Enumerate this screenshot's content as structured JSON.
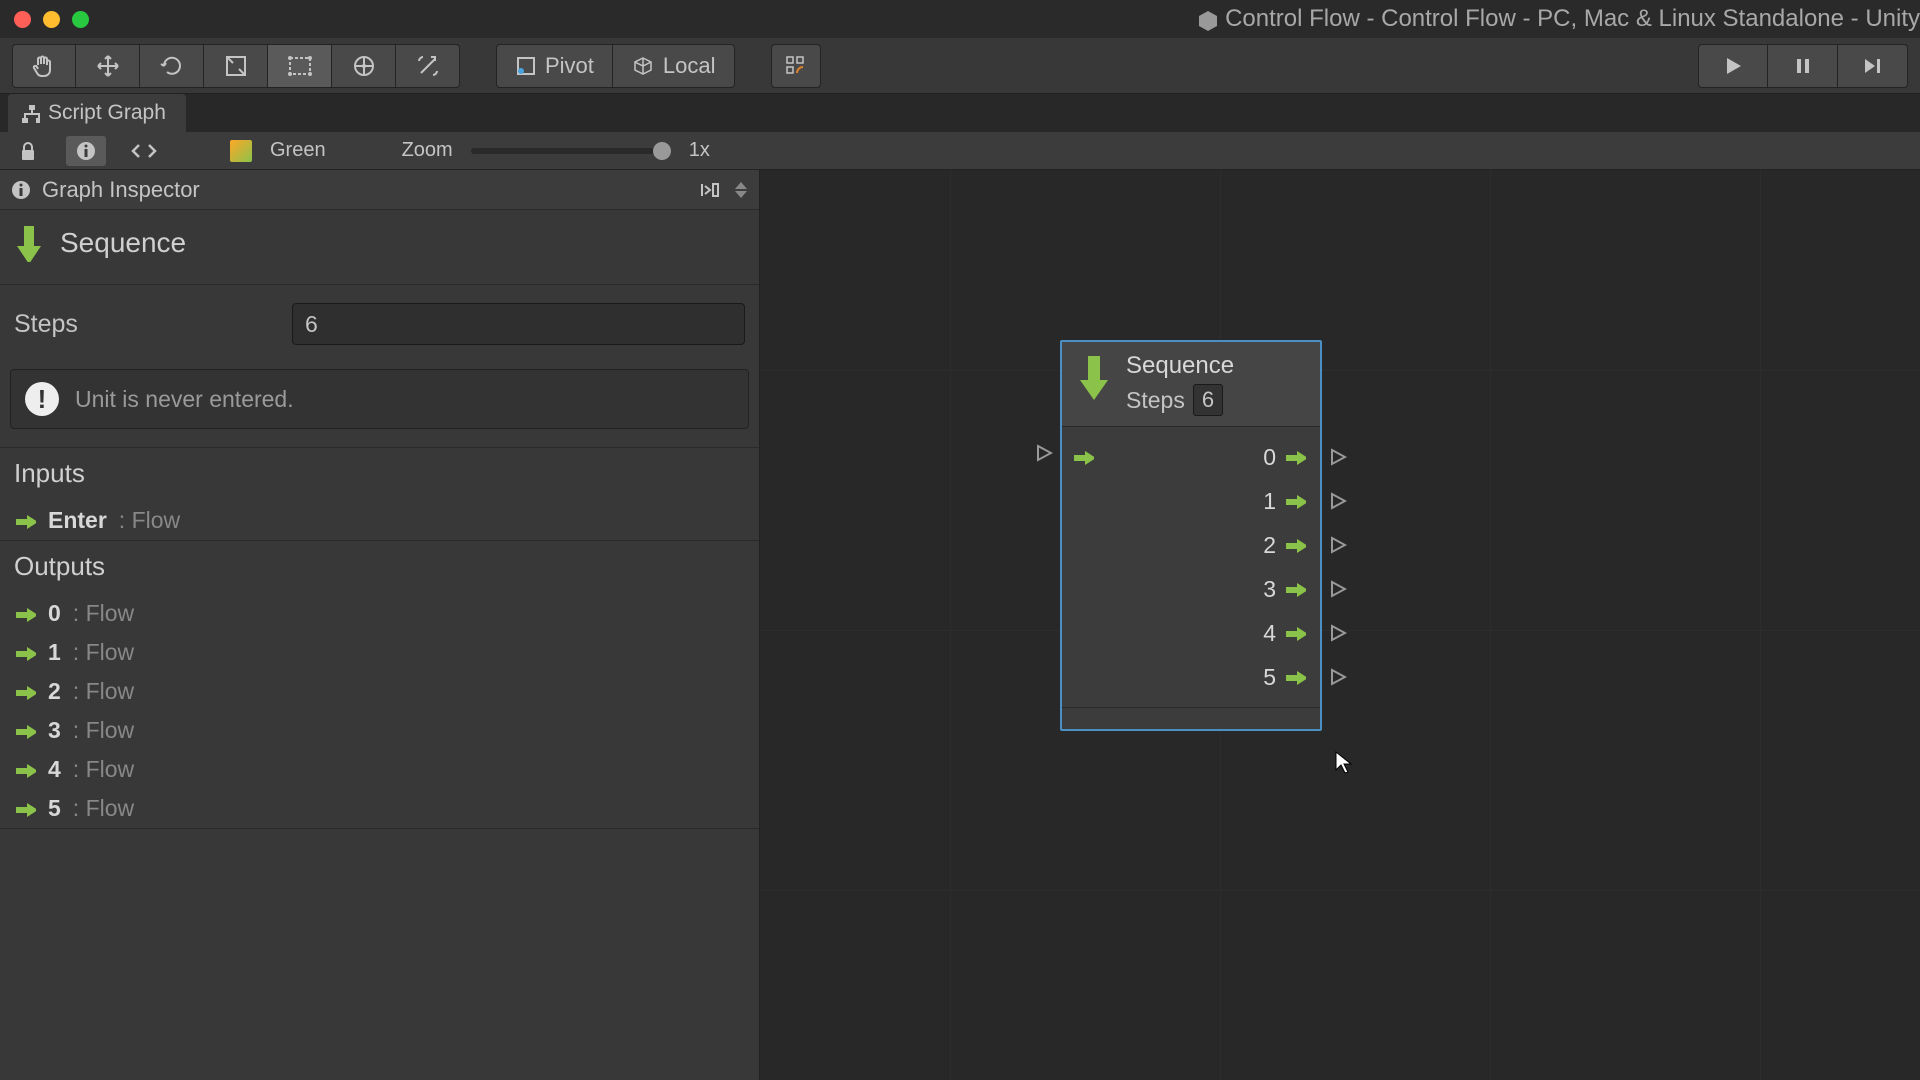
{
  "window": {
    "title": "Control Flow - Control Flow - PC, Mac & Linux Standalone - Unity"
  },
  "toolbar": {
    "pivot_label": "Pivot",
    "local_label": "Local"
  },
  "tabs": {
    "script_graph": "Script Graph"
  },
  "sub_bar": {
    "context_label": "Green",
    "zoom_label": "Zoom",
    "zoom_value": "1x"
  },
  "inspector": {
    "title": "Graph Inspector",
    "node_title": "Sequence",
    "steps_label": "Steps",
    "steps_value": "6",
    "warning": "Unit is never entered.",
    "inputs_label": "Inputs",
    "inputs": [
      {
        "name": "Enter",
        "type": "Flow"
      }
    ],
    "outputs_label": "Outputs",
    "outputs": [
      {
        "name": "0",
        "type": "Flow"
      },
      {
        "name": "1",
        "type": "Flow"
      },
      {
        "name": "2",
        "type": "Flow"
      },
      {
        "name": "3",
        "type": "Flow"
      },
      {
        "name": "4",
        "type": "Flow"
      },
      {
        "name": "5",
        "type": "Flow"
      }
    ]
  },
  "node": {
    "title": "Sequence",
    "steps_label": "Steps",
    "steps_value": "6",
    "outputs": [
      "0",
      "1",
      "2",
      "3",
      "4",
      "5"
    ]
  }
}
